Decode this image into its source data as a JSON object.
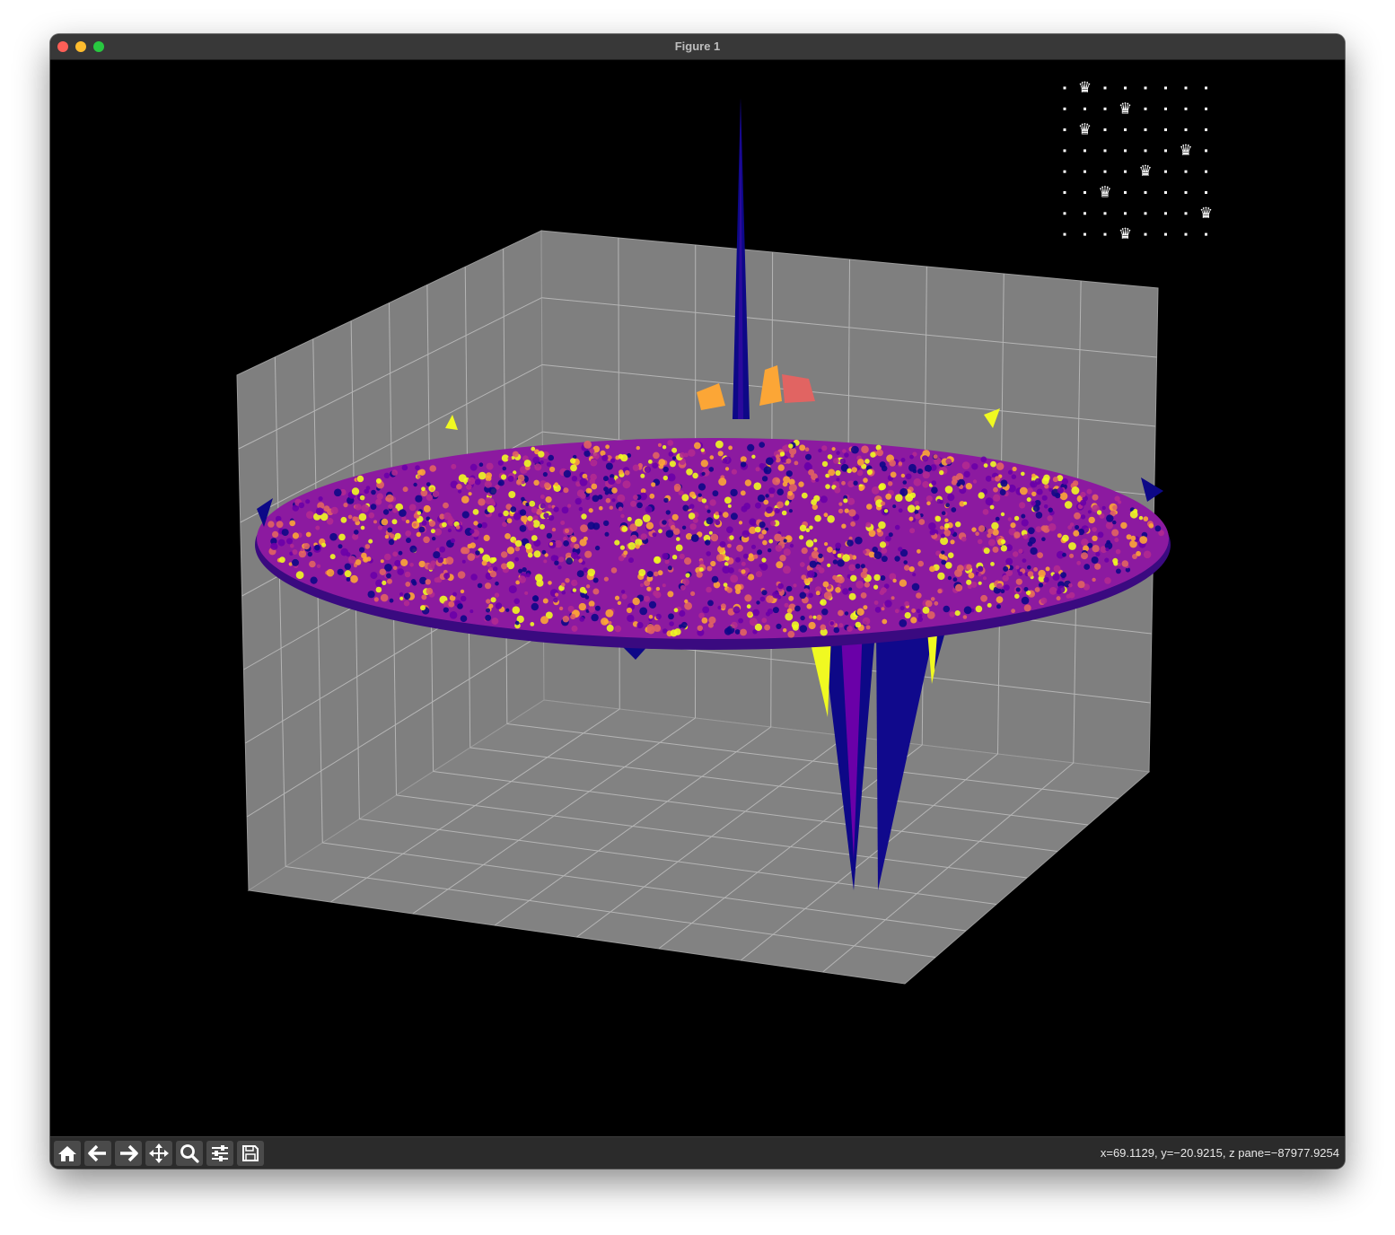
{
  "window": {
    "title": "Figure 1"
  },
  "toolbar": {
    "buttons": [
      {
        "name": "home",
        "icon": "home-icon"
      },
      {
        "name": "back",
        "icon": "arrow-left-icon"
      },
      {
        "name": "forward",
        "icon": "arrow-right-icon"
      },
      {
        "name": "pan",
        "icon": "move-icon"
      },
      {
        "name": "zoom",
        "icon": "magnifier-icon"
      },
      {
        "name": "configure-subplots",
        "icon": "sliders-icon"
      },
      {
        "name": "save",
        "icon": "floppy-disk-icon"
      }
    ]
  },
  "status": {
    "coordinates": "x=69.1129, y=−20.9215, z pane=−87977.9254"
  },
  "inset": {
    "board_size": 8,
    "queen_glyph": "♛",
    "queen_columns_by_row": [
      1,
      3,
      1,
      6,
      4,
      2,
      7,
      3
    ],
    "description_colors": {
      "dot": "#ffffff",
      "queen": "#ffffff"
    }
  },
  "chart_data": {
    "type": "surface",
    "colormap": "plasma",
    "grid": true,
    "background": "#000000",
    "pane_color": "#808080",
    "features": [
      {
        "kind": "spike",
        "direction": "up"
      },
      {
        "kind": "well",
        "direction": "down"
      }
    ]
  },
  "colors": {
    "plasma": [
      "#0d0887",
      "#6a00a8",
      "#b12a90",
      "#e16462",
      "#fca636",
      "#f0f921"
    ],
    "titlebar": "#383838",
    "toolbar": "#2b2b2b"
  }
}
